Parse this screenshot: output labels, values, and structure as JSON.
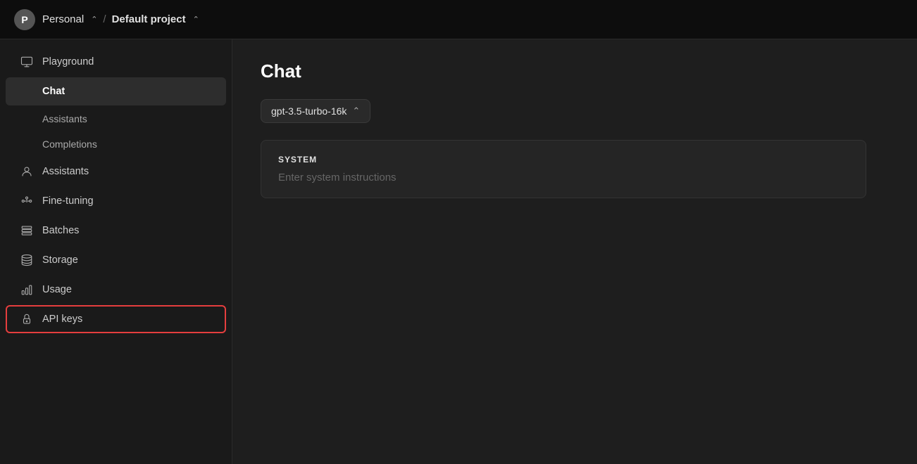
{
  "header": {
    "avatar_letter": "P",
    "org_name": "Personal",
    "separator": "/",
    "project_name": "Default project"
  },
  "sidebar": {
    "top_items": [
      {
        "id": "playground",
        "label": "Playground",
        "icon": "monitor-icon"
      }
    ],
    "playground_subitems": [
      {
        "id": "chat",
        "label": "Chat",
        "active": true
      },
      {
        "id": "assistants-sub",
        "label": "Assistants"
      },
      {
        "id": "completions",
        "label": "Completions"
      }
    ],
    "main_items": [
      {
        "id": "assistants",
        "label": "Assistants",
        "icon": "assistants-icon"
      },
      {
        "id": "fine-tuning",
        "label": "Fine-tuning",
        "icon": "fine-tuning-icon"
      },
      {
        "id": "batches",
        "label": "Batches",
        "icon": "batches-icon"
      },
      {
        "id": "storage",
        "label": "Storage",
        "icon": "storage-icon"
      },
      {
        "id": "usage",
        "label": "Usage",
        "icon": "usage-icon"
      },
      {
        "id": "api-keys",
        "label": "API keys",
        "icon": "api-keys-icon",
        "highlighted": true
      }
    ]
  },
  "main": {
    "page_title": "Chat",
    "model_selector": {
      "label": "gpt-3.5-turbo-16k"
    },
    "system_panel": {
      "label": "SYSTEM",
      "placeholder": "Enter system instructions"
    }
  }
}
